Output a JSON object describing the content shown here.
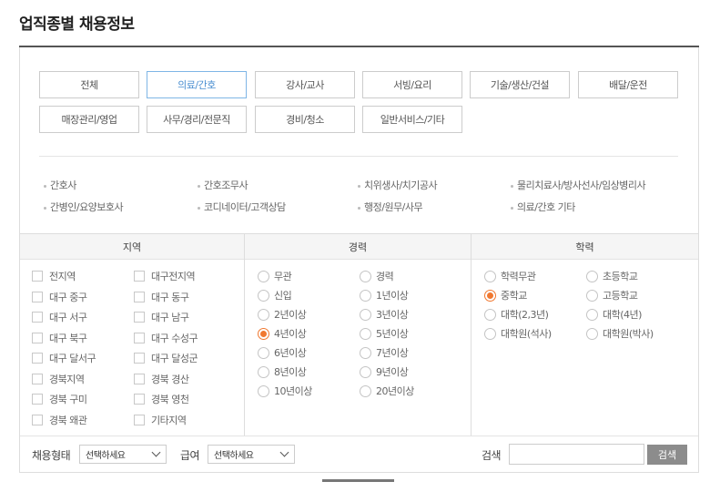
{
  "title": "업직종별 채용정보",
  "categories": [
    {
      "label": "전체",
      "active": false
    },
    {
      "label": "의료/간호",
      "active": true
    },
    {
      "label": "강사/교사",
      "active": false
    },
    {
      "label": "서빙/요리",
      "active": false
    },
    {
      "label": "기술/생산/건설",
      "active": false
    },
    {
      "label": "배달/운전",
      "active": false
    },
    {
      "label": "매장관리/영업",
      "active": false
    },
    {
      "label": "사무/경리/전문직",
      "active": false
    },
    {
      "label": "경비/청소",
      "active": false
    },
    {
      "label": "일반서비스/기타",
      "active": false
    }
  ],
  "subcategories": [
    "간호사",
    "간호조무사",
    "치위생사/치기공사",
    "물리치료사/방사선사/임상병리사",
    "간병인/요양보호사",
    "코디네이터/고객상담",
    "행정/원무/사무",
    "의료/간호 기타"
  ],
  "region": {
    "header": "지역",
    "items": [
      "전지역",
      "대구전지역",
      "대구 중구",
      "대구 동구",
      "대구 서구",
      "대구 남구",
      "대구 북구",
      "대구 수성구",
      "대구 달서구",
      "대구 달성군",
      "경북지역",
      "경북 경산",
      "경북 구미",
      "경북 영천",
      "경북 왜관",
      "기타지역"
    ]
  },
  "career": {
    "header": "경력",
    "items": [
      "무관",
      "경력",
      "신입",
      "1년이상",
      "2년이상",
      "3년이상",
      "4년이상",
      "5년이상",
      "6년이상",
      "7년이상",
      "8년이상",
      "9년이상",
      "10년이상",
      "20년이상"
    ],
    "selected": "4년이상"
  },
  "education": {
    "header": "학력",
    "items": [
      "학력무관",
      "초등학교",
      "중학교",
      "고등학교",
      "대학(2,3년)",
      "대학(4년)",
      "대학원(석사)",
      "대학원(박사)"
    ],
    "selected": "중학교"
  },
  "bottom": {
    "employment_label": "채용형태",
    "employment_value": "선택하세요",
    "salary_label": "급여",
    "salary_value": "선택하세요",
    "search_label": "검색",
    "search_button": "검색"
  }
}
